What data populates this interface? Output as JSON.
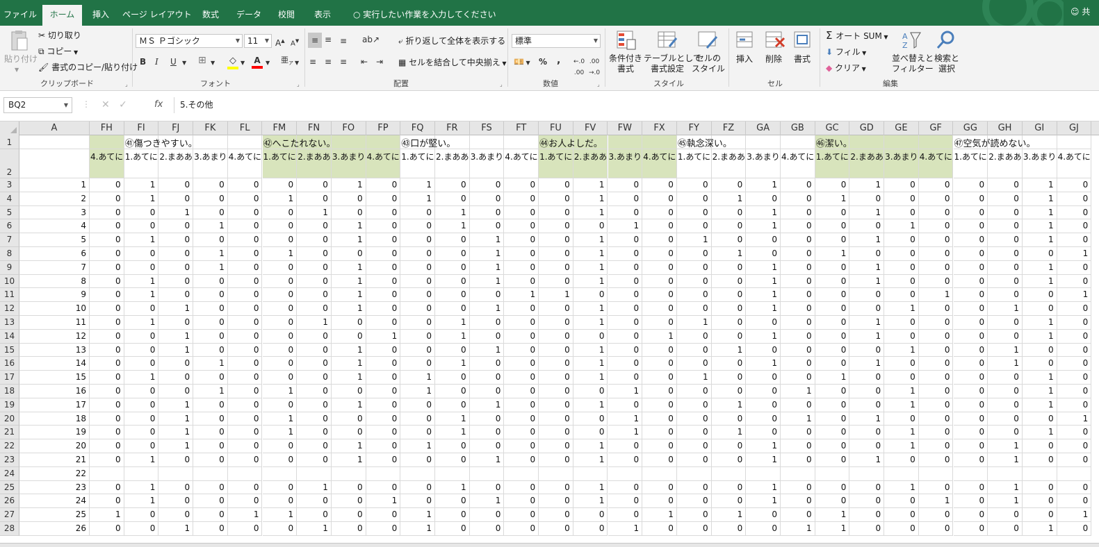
{
  "tabs": [
    "ファイル",
    "ホーム",
    "挿入",
    "ページ レイアウト",
    "数式",
    "データ",
    "校閲",
    "表示"
  ],
  "tell_me": "実行したい作業を入力してください",
  "share_label": "共",
  "ribbon": {
    "clipboard": {
      "paste": "貼り付け",
      "cut": "切り取り",
      "copy": "コピー",
      "format_painter": "書式のコピー/貼り付け",
      "group": "クリップボード"
    },
    "font": {
      "name": "ＭＳ Ｐゴシック",
      "size": "11",
      "group": "フォント",
      "bold": "B",
      "italic": "I",
      "underline": "U"
    },
    "alignment": {
      "wrap": "折り返して全体を表示する",
      "merge": "セルを結合して中央揃え",
      "group": "配置"
    },
    "number": {
      "format": "標準",
      "group": "数値",
      "percent": "%",
      "comma": ","
    },
    "styles": {
      "conditional": "条件付き\n書式",
      "table": "テーブルとして\n書式設定",
      "cell_styles": "セルの\nスタイル",
      "group": "スタイル"
    },
    "cells": {
      "insert": "挿入",
      "delete": "削除",
      "format": "書式",
      "group": "セル"
    },
    "editing": {
      "autosum": "オート SUM",
      "fill": "フィル",
      "clear": "クリア",
      "sort": "並べ替えと\nフィルター",
      "find": "検索と\n選択",
      "group": "編集"
    }
  },
  "formula_bar": {
    "name_box": "BQ2",
    "fx": "fx",
    "content": "5.その他"
  },
  "columns": [
    "A",
    "FH",
    "FI",
    "FJ",
    "FK",
    "FL",
    "FM",
    "FN",
    "FO",
    "FP",
    "FQ",
    "FR",
    "FS",
    "FT",
    "FU",
    "FV",
    "FW",
    "FX",
    "FY",
    "FZ",
    "GA",
    "GB",
    "GC",
    "GD",
    "GE",
    "GF",
    "GG",
    "GH",
    "GI",
    "GJ"
  ],
  "row_numbers": [
    1,
    2,
    3,
    4,
    5,
    6,
    7,
    8,
    9,
    10,
    11,
    12,
    13,
    14,
    15,
    16,
    17,
    18,
    19,
    20,
    21,
    22,
    23,
    24,
    25,
    26,
    27,
    28
  ],
  "questions": [
    {
      "col": 2,
      "text": "㊶傷つきやすい。"
    },
    {
      "col": 6,
      "text": "㊷へこたれない。"
    },
    {
      "col": 10,
      "text": "㊸口が堅い。"
    },
    {
      "col": 14,
      "text": "㊹お人よしだ。"
    },
    {
      "col": 18,
      "text": "㊺執念深い。"
    },
    {
      "col": 22,
      "text": "㊻潔い。"
    },
    {
      "col": 26,
      "text": "㊼空気が読めない。"
    }
  ],
  "subheaders": [
    "",
    "4.あてに",
    "1.あてに",
    "2.まああ",
    "3.あまり",
    "4.あてに",
    "1.あてに",
    "2.まああ",
    "3.あまり",
    "4.あてに",
    "1.あてに",
    "2.まああ",
    "3.あまり",
    "4.あてに",
    "1.あてに",
    "2.まああ",
    "3.あまり",
    "4.あてに",
    "1.あてに",
    "2.まああ",
    "3.あまり",
    "4.あてに",
    "1.あてに",
    "2.まああ",
    "3.あまり",
    "4.あてに",
    "1.あてに",
    "2.まああ",
    "3.あまり",
    "4.あてに"
  ],
  "data_rows": [
    [
      "1",
      "0",
      "1",
      "0",
      "0",
      "0",
      "0",
      "0",
      "1",
      "0",
      "1",
      "0",
      "0",
      "0",
      "0",
      "1",
      "0",
      "0",
      "0",
      "0",
      "1",
      "0",
      "0",
      "1",
      "0",
      "0",
      "0",
      "0",
      "1",
      "0"
    ],
    [
      "2",
      "0",
      "1",
      "0",
      "0",
      "0",
      "1",
      "0",
      "0",
      "0",
      "1",
      "0",
      "0",
      "0",
      "0",
      "1",
      "0",
      "0",
      "0",
      "1",
      "0",
      "0",
      "1",
      "0",
      "0",
      "0",
      "0",
      "0",
      "1",
      "0"
    ],
    [
      "3",
      "0",
      "0",
      "1",
      "0",
      "0",
      "0",
      "1",
      "0",
      "0",
      "0",
      "1",
      "0",
      "0",
      "0",
      "1",
      "0",
      "0",
      "0",
      "0",
      "1",
      "0",
      "0",
      "1",
      "0",
      "0",
      "0",
      "0",
      "1",
      "0"
    ],
    [
      "4",
      "0",
      "0",
      "0",
      "1",
      "0",
      "0",
      "0",
      "1",
      "0",
      "0",
      "1",
      "0",
      "0",
      "0",
      "0",
      "1",
      "0",
      "0",
      "0",
      "1",
      "0",
      "0",
      "0",
      "1",
      "0",
      "0",
      "0",
      "1",
      "0"
    ],
    [
      "5",
      "0",
      "1",
      "0",
      "0",
      "0",
      "0",
      "0",
      "1",
      "0",
      "0",
      "0",
      "1",
      "0",
      "0",
      "1",
      "0",
      "0",
      "1",
      "0",
      "0",
      "0",
      "0",
      "1",
      "0",
      "0",
      "0",
      "0",
      "1",
      "0"
    ],
    [
      "6",
      "0",
      "0",
      "0",
      "1",
      "0",
      "1",
      "0",
      "0",
      "0",
      "0",
      "0",
      "1",
      "0",
      "0",
      "1",
      "0",
      "0",
      "0",
      "1",
      "0",
      "0",
      "1",
      "0",
      "0",
      "0",
      "0",
      "0",
      "0",
      "1"
    ],
    [
      "7",
      "0",
      "0",
      "0",
      "1",
      "0",
      "0",
      "0",
      "1",
      "0",
      "0",
      "0",
      "1",
      "0",
      "0",
      "1",
      "0",
      "0",
      "0",
      "0",
      "1",
      "0",
      "0",
      "1",
      "0",
      "0",
      "0",
      "0",
      "1",
      "0"
    ],
    [
      "8",
      "0",
      "1",
      "0",
      "0",
      "0",
      "0",
      "0",
      "1",
      "0",
      "0",
      "0",
      "1",
      "0",
      "0",
      "1",
      "0",
      "0",
      "0",
      "0",
      "1",
      "0",
      "0",
      "1",
      "0",
      "0",
      "0",
      "0",
      "1",
      "0"
    ],
    [
      "9",
      "0",
      "1",
      "0",
      "0",
      "0",
      "0",
      "0",
      "1",
      "0",
      "0",
      "0",
      "0",
      "1",
      "1",
      "0",
      "0",
      "0",
      "0",
      "0",
      "1",
      "0",
      "0",
      "0",
      "0",
      "1",
      "0",
      "0",
      "0",
      "1"
    ],
    [
      "10",
      "0",
      "0",
      "1",
      "0",
      "0",
      "0",
      "0",
      "1",
      "0",
      "0",
      "0",
      "1",
      "0",
      "0",
      "1",
      "0",
      "0",
      "0",
      "0",
      "1",
      "0",
      "0",
      "0",
      "1",
      "0",
      "0",
      "1",
      "0",
      "0"
    ],
    [
      "11",
      "0",
      "1",
      "0",
      "0",
      "0",
      "0",
      "1",
      "0",
      "0",
      "0",
      "1",
      "0",
      "0",
      "0",
      "1",
      "0",
      "0",
      "1",
      "0",
      "0",
      "0",
      "0",
      "1",
      "0",
      "0",
      "0",
      "0",
      "1",
      "0"
    ],
    [
      "12",
      "0",
      "0",
      "1",
      "0",
      "0",
      "0",
      "0",
      "0",
      "1",
      "0",
      "1",
      "0",
      "0",
      "0",
      "0",
      "0",
      "1",
      "0",
      "0",
      "1",
      "0",
      "0",
      "1",
      "0",
      "0",
      "0",
      "0",
      "1",
      "0"
    ],
    [
      "13",
      "0",
      "0",
      "1",
      "0",
      "0",
      "0",
      "0",
      "1",
      "0",
      "0",
      "0",
      "1",
      "0",
      "0",
      "1",
      "0",
      "0",
      "0",
      "1",
      "0",
      "0",
      "0",
      "0",
      "1",
      "0",
      "0",
      "1",
      "0",
      "0"
    ],
    [
      "14",
      "0",
      "0",
      "0",
      "1",
      "0",
      "0",
      "0",
      "1",
      "0",
      "0",
      "1",
      "0",
      "0",
      "0",
      "1",
      "0",
      "0",
      "0",
      "0",
      "1",
      "0",
      "0",
      "1",
      "0",
      "0",
      "0",
      "1",
      "0",
      "0"
    ],
    [
      "15",
      "0",
      "1",
      "0",
      "0",
      "0",
      "0",
      "0",
      "1",
      "0",
      "1",
      "0",
      "0",
      "0",
      "0",
      "1",
      "0",
      "0",
      "1",
      "0",
      "0",
      "0",
      "1",
      "0",
      "0",
      "0",
      "0",
      "0",
      "1",
      "0"
    ],
    [
      "16",
      "0",
      "0",
      "0",
      "1",
      "0",
      "1",
      "0",
      "0",
      "0",
      "1",
      "0",
      "0",
      "0",
      "0",
      "0",
      "1",
      "0",
      "0",
      "0",
      "0",
      "1",
      "0",
      "0",
      "1",
      "0",
      "0",
      "0",
      "1",
      "0"
    ],
    [
      "17",
      "0",
      "0",
      "1",
      "0",
      "0",
      "0",
      "0",
      "1",
      "0",
      "0",
      "0",
      "1",
      "0",
      "0",
      "1",
      "0",
      "0",
      "0",
      "1",
      "0",
      "0",
      "0",
      "0",
      "1",
      "0",
      "0",
      "0",
      "1",
      "0"
    ],
    [
      "18",
      "0",
      "0",
      "1",
      "0",
      "0",
      "1",
      "0",
      "0",
      "0",
      "0",
      "1",
      "0",
      "0",
      "0",
      "0",
      "1",
      "0",
      "0",
      "0",
      "0",
      "1",
      "0",
      "1",
      "0",
      "0",
      "0",
      "0",
      "0",
      "1"
    ],
    [
      "19",
      "0",
      "0",
      "1",
      "0",
      "0",
      "1",
      "0",
      "0",
      "0",
      "0",
      "1",
      "0",
      "0",
      "0",
      "0",
      "1",
      "0",
      "0",
      "1",
      "0",
      "0",
      "0",
      "0",
      "1",
      "0",
      "0",
      "0",
      "1",
      "0"
    ],
    [
      "20",
      "0",
      "0",
      "1",
      "0",
      "0",
      "0",
      "0",
      "1",
      "0",
      "1",
      "0",
      "0",
      "0",
      "0",
      "1",
      "0",
      "0",
      "0",
      "0",
      "1",
      "0",
      "0",
      "0",
      "1",
      "0",
      "0",
      "1",
      "0",
      "0"
    ],
    [
      "21",
      "0",
      "1",
      "0",
      "0",
      "0",
      "0",
      "0",
      "1",
      "0",
      "0",
      "0",
      "1",
      "0",
      "0",
      "1",
      "0",
      "0",
      "0",
      "0",
      "1",
      "0",
      "0",
      "1",
      "0",
      "0",
      "0",
      "1",
      "0",
      "0"
    ],
    [
      "22",
      "",
      "",
      "",
      "",
      "",
      "",
      "",
      "",
      "",
      "",
      "",
      "",
      "",
      "",
      "",
      "",
      "",
      "",
      "",
      "",
      "",
      "",
      "",
      "",
      "",
      "",
      "",
      "",
      ""
    ],
    [
      "23",
      "0",
      "1",
      "0",
      "0",
      "0",
      "0",
      "1",
      "0",
      "0",
      "0",
      "1",
      "0",
      "0",
      "0",
      "1",
      "0",
      "0",
      "0",
      "0",
      "1",
      "0",
      "0",
      "0",
      "1",
      "0",
      "0",
      "1",
      "0",
      "0"
    ],
    [
      "24",
      "0",
      "1",
      "0",
      "0",
      "0",
      "0",
      "0",
      "0",
      "1",
      "0",
      "0",
      "1",
      "0",
      "0",
      "1",
      "0",
      "0",
      "0",
      "0",
      "1",
      "0",
      "0",
      "0",
      "0",
      "1",
      "0",
      "1",
      "0",
      "0"
    ],
    [
      "25",
      "1",
      "0",
      "0",
      "0",
      "1",
      "1",
      "0",
      "0",
      "0",
      "1",
      "0",
      "0",
      "0",
      "0",
      "0",
      "0",
      "1",
      "0",
      "1",
      "0",
      "0",
      "1",
      "0",
      "0",
      "0",
      "0",
      "0",
      "0",
      "1"
    ],
    [
      "26",
      "0",
      "0",
      "1",
      "0",
      "0",
      "0",
      "1",
      "0",
      "0",
      "1",
      "0",
      "0",
      "0",
      "0",
      "0",
      "1",
      "0",
      "0",
      "0",
      "0",
      "1",
      "1",
      "0",
      "0",
      "0",
      "0",
      "0",
      "1",
      "0"
    ]
  ],
  "colors": {
    "excel_green": "#217346",
    "header_fill": "#d8e4bc",
    "grid_header": "#e6e6e6"
  }
}
